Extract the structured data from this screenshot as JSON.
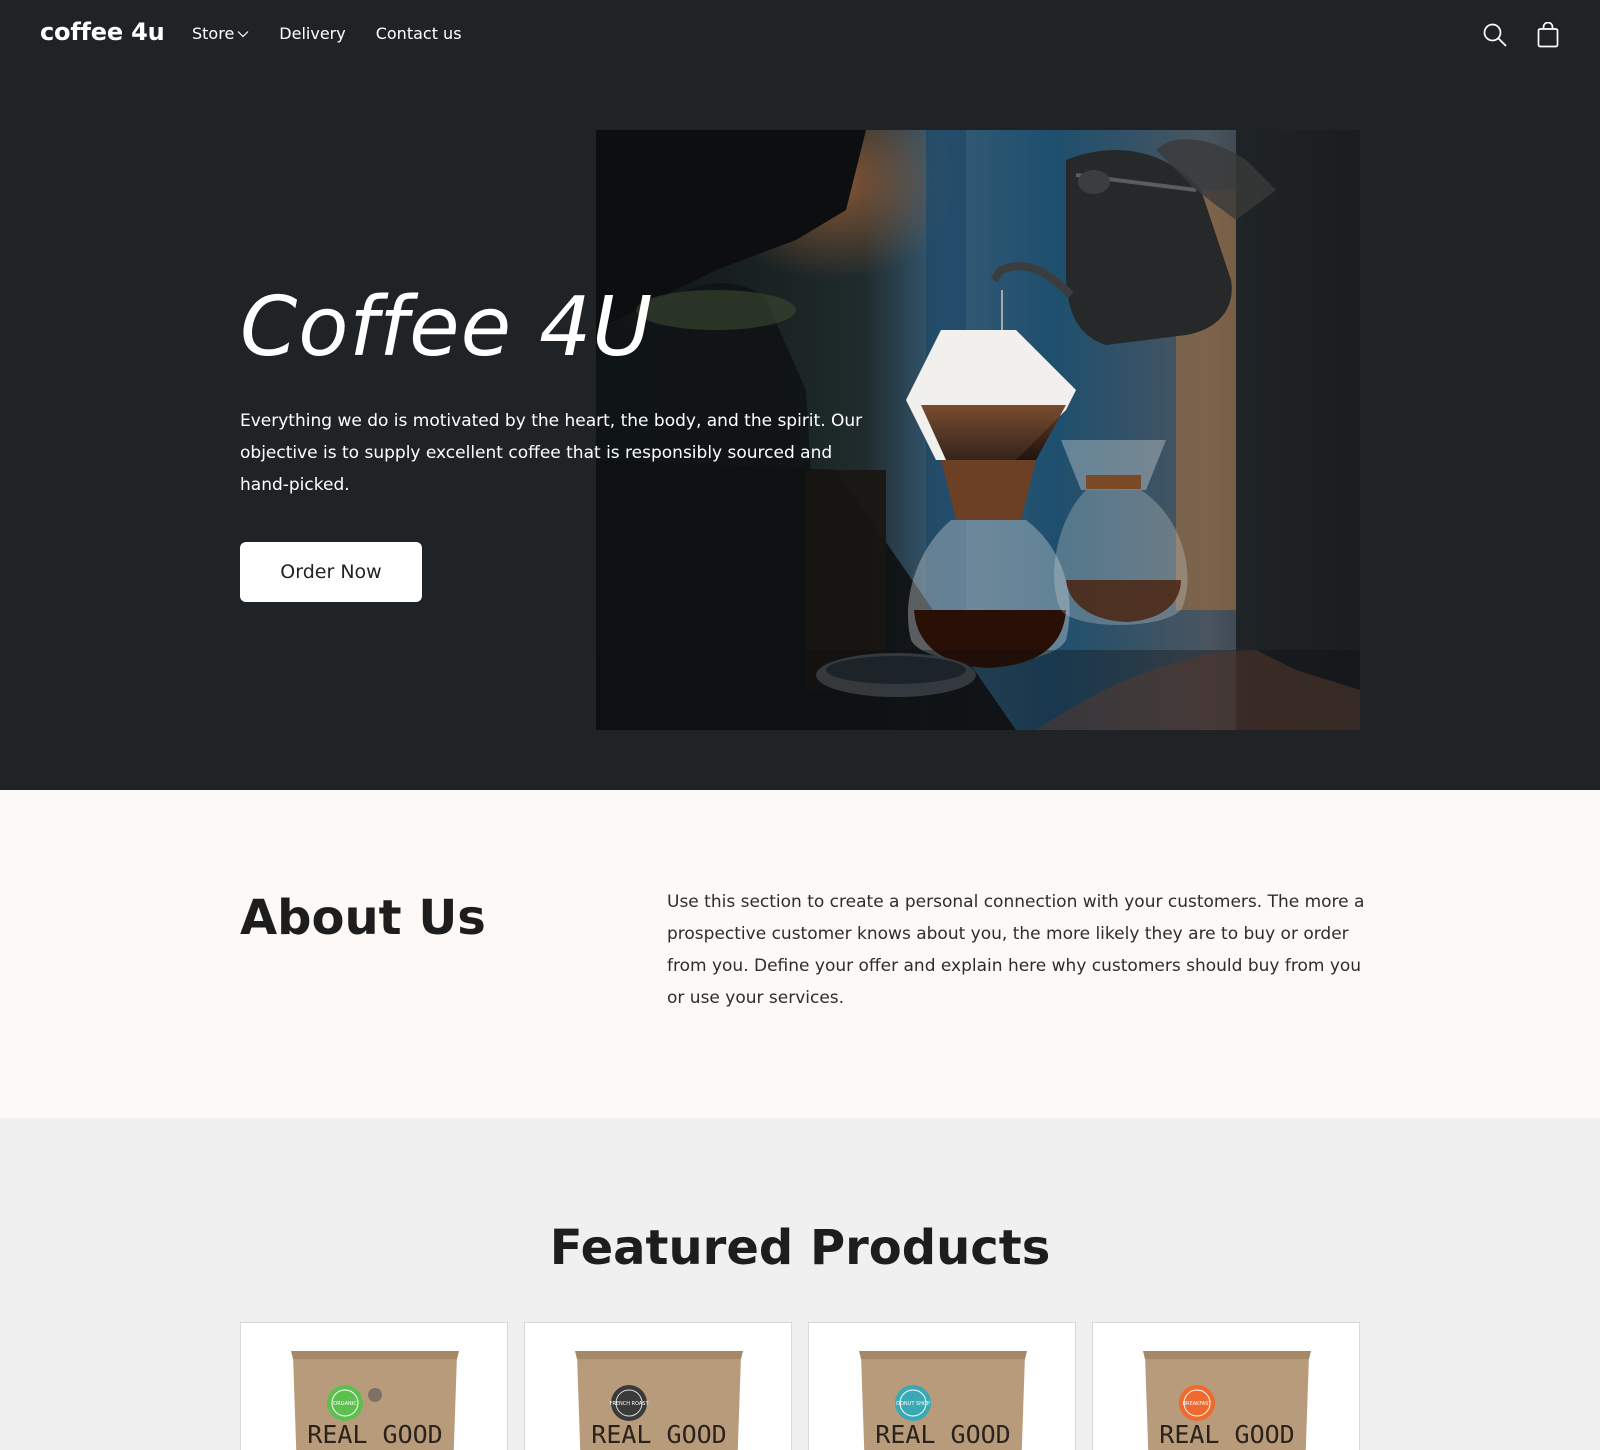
{
  "header": {
    "logo": "coffee 4u",
    "nav": [
      {
        "label": "Store",
        "has_dropdown": true
      },
      {
        "label": "Delivery"
      },
      {
        "label": "Contact us"
      }
    ],
    "icons": [
      "search-icon",
      "shopping-bag-icon"
    ]
  },
  "hero": {
    "title": "Coffee 4U",
    "text": "Everything we do is motivated by the heart, the body, and the spirit. Our objective is to supply excellent coffee that is responsibly sourced and hand-picked.",
    "button_label": "Order Now",
    "image": "pour-over-coffee-photo"
  },
  "about": {
    "title": "About Us",
    "text": "Use this section to create a personal connection with your customers. The more a prospective customer knows about you, the more likely they are to buy or order from you. Define your offer and explain here why customers should buy from you or use your services."
  },
  "featured": {
    "title": "Featured Products",
    "products": [
      {
        "bag_text": "REAL GOOD",
        "label_text": "ORGANIC",
        "label_color": "#5cbf4f"
      },
      {
        "bag_text": "REAL GOOD",
        "label_text": "FRENCH ROAST",
        "label_color": "#3a3a3a"
      },
      {
        "bag_text": "REAL GOOD",
        "label_text": "DONUT SHOP",
        "label_color": "#3aa9b5"
      },
      {
        "bag_text": "REAL GOOD",
        "label_text": "BREAKFAST",
        "label_color": "#ee6a2e"
      }
    ]
  }
}
